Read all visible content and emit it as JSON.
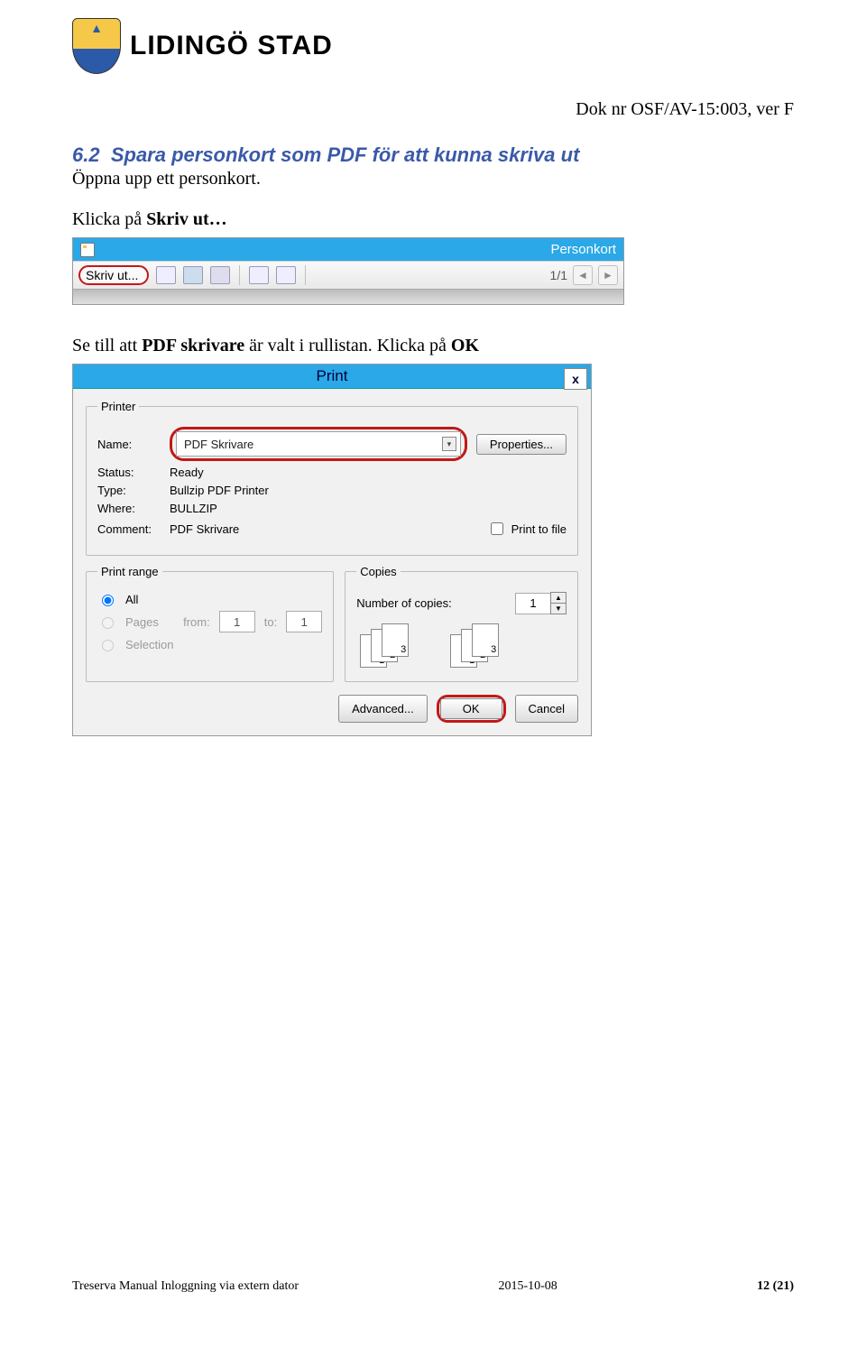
{
  "header": {
    "brand": "LIDINGÖ STAD"
  },
  "doc": {
    "doknr": "Dok nr OSF/AV-15:003, ver F",
    "section_num": "6.2",
    "section_title": "Spara personkort som PDF för att kunna skriva ut",
    "para1": "Öppna upp ett personkort.",
    "para2a": "Klicka på ",
    "para2b": "Skriv ut…",
    "para3a": "Se till att ",
    "para3b": "PDF skrivare",
    "para3c": " är valt i rullistan. Klicka på ",
    "para3d": "OK"
  },
  "shot1": {
    "window_title": "Personkort",
    "print_btn": "Skriv ut...",
    "pager": "1/1"
  },
  "printDialog": {
    "title": "Print",
    "close": "x",
    "printer_legend": "Printer",
    "name_label": "Name:",
    "name_value": "PDF Skrivare",
    "properties": "Properties...",
    "status_label": "Status:",
    "status_value": "Ready",
    "type_label": "Type:",
    "type_value": "Bullzip PDF Printer",
    "where_label": "Where:",
    "where_value": "BULLZIP",
    "comment_label": "Comment:",
    "comment_value": "PDF Skrivare",
    "print_to_file": "Print to file",
    "range_legend": "Print range",
    "range_all": "All",
    "range_pages": "Pages",
    "range_from": "from:",
    "range_to": "to:",
    "range_from_val": "1",
    "range_to_val": "1",
    "range_selection": "Selection",
    "copies_legend": "Copies",
    "copies_label": "Number of copies:",
    "copies_value": "1",
    "advanced": "Advanced...",
    "ok": "OK",
    "cancel": "Cancel"
  },
  "footer": {
    "left": "Treserva Manual Inloggning via extern dator",
    "center": "2015-10-08",
    "right": "12 (21)"
  }
}
